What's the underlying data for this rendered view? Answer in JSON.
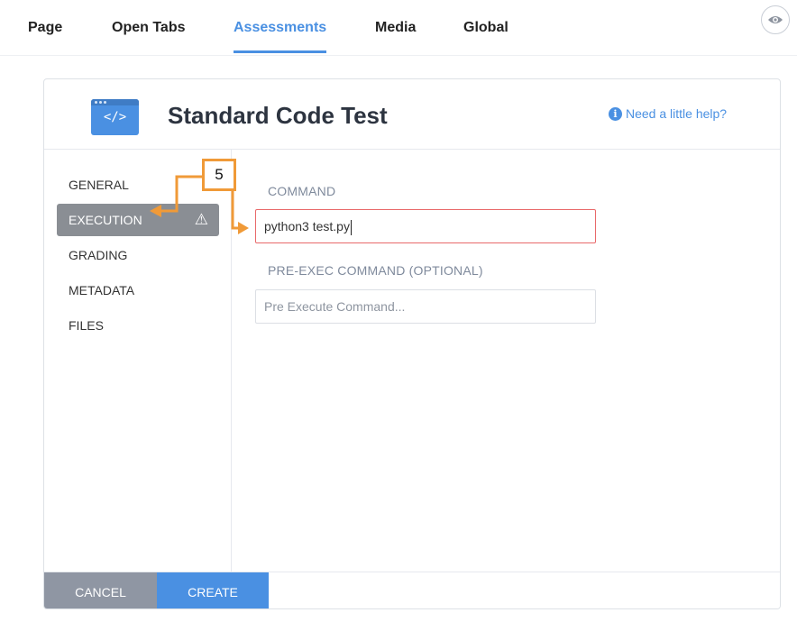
{
  "top_tabs": [
    {
      "label": "Page"
    },
    {
      "label": "Open Tabs"
    },
    {
      "label": "Assessments"
    },
    {
      "label": "Media"
    },
    {
      "label": "Global"
    }
  ],
  "active_tab": "Assessments",
  "accent_color": "#4a90e2",
  "annotation_color": "#f09a38",
  "dialog": {
    "icon": "code-window-icon",
    "icon_glyph": "</>",
    "title": "Standard Code Test",
    "help_label": "Need a little help?",
    "sidebar": [
      {
        "label": "GENERAL"
      },
      {
        "label": "EXECUTION",
        "warning_icon": "⚠"
      },
      {
        "label": "GRADING"
      },
      {
        "label": "METADATA"
      },
      {
        "label": "FILES"
      }
    ],
    "active_section": "EXECUTION",
    "command_label": "COMMAND",
    "command_value": "python3 test.py",
    "pre_exec_label": "PRE-EXEC COMMAND (OPTIONAL)",
    "pre_exec_placeholder": "Pre Execute Command...",
    "cancel_label": "CANCEL",
    "create_label": "CREATE"
  },
  "annotation": {
    "number": "5"
  }
}
